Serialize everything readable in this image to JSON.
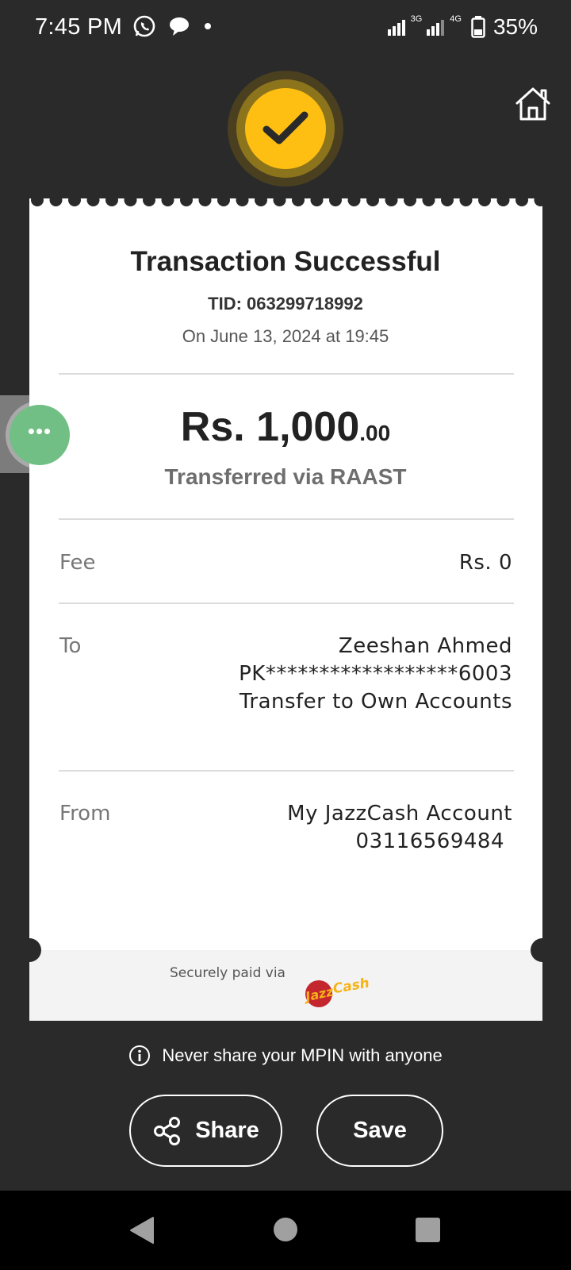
{
  "status_bar": {
    "time": "7:45 PM",
    "network_1": "3G",
    "network_2": "4G",
    "battery": "35%",
    "icons": [
      "whatsapp-icon",
      "chat-bubble-icon",
      "dot-icon",
      "signal-icon",
      "battery-icon"
    ]
  },
  "receipt": {
    "title": "Transaction Successful",
    "tid": "TID: 063299718992",
    "date": "On June 13, 2024 at 19:45",
    "amount_main": "Rs. 1,000",
    "amount_decimal": ".00",
    "via": "Transferred via RAAST",
    "fee_label": "Fee",
    "fee_value": "Rs. 0",
    "to_label": "To",
    "to_name": "Zeeshan Ahmed",
    "to_account": "PK******************6003",
    "to_type": "Transfer to Own Accounts",
    "from_label": "From",
    "from_account_name": "My JazzCash Account",
    "from_number": "03116569484",
    "footer_text": "Securely paid via",
    "logo_text_1": "Jazz",
    "logo_text_2": "Cash"
  },
  "warning_text": "Never share your MPIN with anyone",
  "actions": {
    "share_label": "Share",
    "save_label": "Save"
  },
  "floating_bubble": "•••",
  "colors": {
    "background": "#2a2a2a",
    "accent": "#ffbf12",
    "bubble": "#71bf84",
    "logo_red": "#c4262e",
    "logo_yellow": "#f5b416"
  }
}
